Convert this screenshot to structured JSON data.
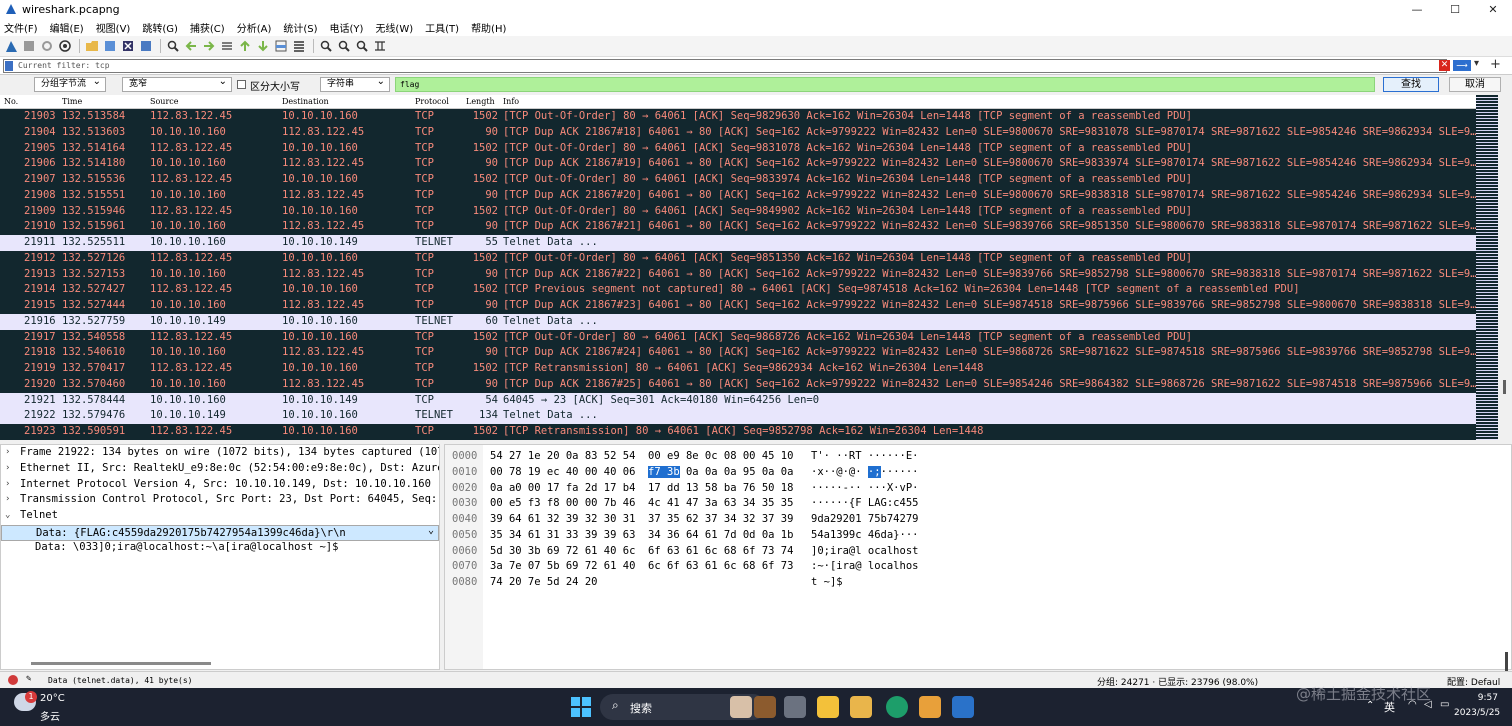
{
  "window": {
    "title": "wireshark.pcapng",
    "minimize": "—",
    "maximize": "☐",
    "close": "✕"
  },
  "menu": [
    "文件(F)",
    "编辑(E)",
    "视图(V)",
    "跳转(G)",
    "捕获(C)",
    "分析(A)",
    "统计(S)",
    "电话(Y)",
    "无线(W)",
    "工具(T)",
    "帮助(H)"
  ],
  "toolbar_icons": [
    "fin-icon",
    "stop-icon",
    "restart-icon",
    "options-icon",
    "open-icon",
    "save-icon",
    "close-file-icon",
    "reload-icon",
    "find-icon",
    "back-icon",
    "forward-icon",
    "goto-icon",
    "first-icon",
    "last-icon",
    "autoscroll-icon",
    "colorize-icon",
    "zoom-in-icon",
    "zoom-out-icon",
    "zoom-reset-icon",
    "resize-columns-icon"
  ],
  "filter": {
    "placeholder": "Current filter: tcp"
  },
  "search": {
    "scope": "分组字节流",
    "charset": "宽窄",
    "case_label": "区分大小写",
    "type": "字符串",
    "query": "flag",
    "find_label": "查找",
    "cancel_label": "取消"
  },
  "columns": [
    "No.",
    "Time",
    "Source",
    "Destination",
    "Protocol",
    "Length",
    "Info"
  ],
  "packets": [
    {
      "no": "21903",
      "time": "132.513584",
      "src": "112.83.122.45",
      "dst": "10.10.10.160",
      "proto": "TCP",
      "len": "1502",
      "info": "[TCP Out-Of-Order] 80 → 64061 [ACK] Seq=9829630 Ack=162 Win=26304 Len=1448 [TCP segment of a reassembled PDU]",
      "light": false
    },
    {
      "no": "21904",
      "time": "132.513603",
      "src": "10.10.10.160",
      "dst": "112.83.122.45",
      "proto": "TCP",
      "len": "90",
      "info": "[TCP Dup ACK 21867#18] 64061 → 80 [ACK] Seq=162 Ack=9799222 Win=82432 Len=0 SLE=9800670 SRE=9831078 SLE=9870174 SRE=9871622 SLE=9854246 SRE=9862934 SLE=9…",
      "light": false
    },
    {
      "no": "21905",
      "time": "132.514164",
      "src": "112.83.122.45",
      "dst": "10.10.10.160",
      "proto": "TCP",
      "len": "1502",
      "info": "[TCP Out-Of-Order] 80 → 64061 [ACK] Seq=9831078 Ack=162 Win=26304 Len=1448 [TCP segment of a reassembled PDU]",
      "light": false
    },
    {
      "no": "21906",
      "time": "132.514180",
      "src": "10.10.10.160",
      "dst": "112.83.122.45",
      "proto": "TCP",
      "len": "90",
      "info": "[TCP Dup ACK 21867#19] 64061 → 80 [ACK] Seq=162 Ack=9799222 Win=82432 Len=0 SLE=9800670 SRE=9833974 SLE=9870174 SRE=9871622 SLE=9854246 SRE=9862934 SLE=9…",
      "light": false
    },
    {
      "no": "21907",
      "time": "132.515536",
      "src": "112.83.122.45",
      "dst": "10.10.10.160",
      "proto": "TCP",
      "len": "1502",
      "info": "[TCP Out-Of-Order] 80 → 64061 [ACK] Seq=9833974 Ack=162 Win=26304 Len=1448 [TCP segment of a reassembled PDU]",
      "light": false
    },
    {
      "no": "21908",
      "time": "132.515551",
      "src": "10.10.10.160",
      "dst": "112.83.122.45",
      "proto": "TCP",
      "len": "90",
      "info": "[TCP Dup ACK 21867#20] 64061 → 80 [ACK] Seq=162 Ack=9799222 Win=82432 Len=0 SLE=9800670 SRE=9838318 SLE=9870174 SRE=9871622 SLE=9854246 SRE=9862934 SLE=9…",
      "light": false
    },
    {
      "no": "21909",
      "time": "132.515946",
      "src": "112.83.122.45",
      "dst": "10.10.10.160",
      "proto": "TCP",
      "len": "1502",
      "info": "[TCP Out-Of-Order] 80 → 64061 [ACK] Seq=9849902 Ack=162 Win=26304 Len=1448 [TCP segment of a reassembled PDU]",
      "light": false
    },
    {
      "no": "21910",
      "time": "132.515961",
      "src": "10.10.10.160",
      "dst": "112.83.122.45",
      "proto": "TCP",
      "len": "90",
      "info": "[TCP Dup ACK 21867#21] 64061 → 80 [ACK] Seq=162 Ack=9799222 Win=82432 Len=0 SLE=9839766 SRE=9851350 SLE=9800670 SRE=9838318 SLE=9870174 SRE=9871622 SLE=9…",
      "light": false
    },
    {
      "no": "21911",
      "time": "132.525511",
      "src": "10.10.10.160",
      "dst": "10.10.10.149",
      "proto": "TELNET",
      "len": "55",
      "info": "Telnet Data ...",
      "light": true
    },
    {
      "no": "21912",
      "time": "132.527126",
      "src": "112.83.122.45",
      "dst": "10.10.10.160",
      "proto": "TCP",
      "len": "1502",
      "info": "[TCP Out-Of-Order] 80 → 64061 [ACK] Seq=9851350 Ack=162 Win=26304 Len=1448 [TCP segment of a reassembled PDU]",
      "light": false
    },
    {
      "no": "21913",
      "time": "132.527153",
      "src": "10.10.10.160",
      "dst": "112.83.122.45",
      "proto": "TCP",
      "len": "90",
      "info": "[TCP Dup ACK 21867#22] 64061 → 80 [ACK] Seq=162 Ack=9799222 Win=82432 Len=0 SLE=9839766 SRE=9852798 SLE=9800670 SRE=9838318 SLE=9870174 SRE=9871622 SLE=9…",
      "light": false
    },
    {
      "no": "21914",
      "time": "132.527427",
      "src": "112.83.122.45",
      "dst": "10.10.10.160",
      "proto": "TCP",
      "len": "1502",
      "info": "[TCP Previous segment not captured] 80 → 64061 [ACK] Seq=9874518 Ack=162 Win=26304 Len=1448 [TCP segment of a reassembled PDU]",
      "light": false
    },
    {
      "no": "21915",
      "time": "132.527444",
      "src": "10.10.10.160",
      "dst": "112.83.122.45",
      "proto": "TCP",
      "len": "90",
      "info": "[TCP Dup ACK 21867#23] 64061 → 80 [ACK] Seq=162 Ack=9799222 Win=82432 Len=0 SLE=9874518 SRE=9875966 SLE=9839766 SRE=9852798 SLE=9800670 SRE=9838318 SLE=9…",
      "light": false
    },
    {
      "no": "21916",
      "time": "132.527759",
      "src": "10.10.10.149",
      "dst": "10.10.10.160",
      "proto": "TELNET",
      "len": "60",
      "info": "Telnet Data ...",
      "light": true
    },
    {
      "no": "21917",
      "time": "132.540558",
      "src": "112.83.122.45",
      "dst": "10.10.10.160",
      "proto": "TCP",
      "len": "1502",
      "info": "[TCP Out-Of-Order] 80 → 64061 [ACK] Seq=9868726 Ack=162 Win=26304 Len=1448 [TCP segment of a reassembled PDU]",
      "light": false
    },
    {
      "no": "21918",
      "time": "132.540610",
      "src": "10.10.10.160",
      "dst": "112.83.122.45",
      "proto": "TCP",
      "len": "90",
      "info": "[TCP Dup ACK 21867#24] 64061 → 80 [ACK] Seq=162 Ack=9799222 Win=82432 Len=0 SLE=9868726 SRE=9871622 SLE=9874518 SRE=9875966 SLE=9839766 SRE=9852798 SLE=9…",
      "light": false
    },
    {
      "no": "21919",
      "time": "132.570417",
      "src": "112.83.122.45",
      "dst": "10.10.10.160",
      "proto": "TCP",
      "len": "1502",
      "info": "[TCP Retransmission] 80 → 64061 [ACK] Seq=9862934 Ack=162 Win=26304 Len=1448",
      "light": false
    },
    {
      "no": "21920",
      "time": "132.570460",
      "src": "10.10.10.160",
      "dst": "112.83.122.45",
      "proto": "TCP",
      "len": "90",
      "info": "[TCP Dup ACK 21867#25] 64061 → 80 [ACK] Seq=162 Ack=9799222 Win=82432 Len=0 SLE=9854246 SRE=9864382 SLE=9868726 SRE=9871622 SLE=9874518 SRE=9875966 SLE=9…",
      "light": false
    },
    {
      "no": "21921",
      "time": "132.578444",
      "src": "10.10.10.160",
      "dst": "10.10.10.149",
      "proto": "TCP",
      "len": "54",
      "info": "64045 → 23 [ACK] Seq=301 Ack=40180 Win=64256 Len=0",
      "light": true
    },
    {
      "no": "21922",
      "time": "132.579476",
      "src": "10.10.10.149",
      "dst": "10.10.10.160",
      "proto": "TELNET",
      "len": "134",
      "info": "Telnet Data ...",
      "light": true
    },
    {
      "no": "21923",
      "time": "132.590591",
      "src": "112.83.122.45",
      "dst": "10.10.10.160",
      "proto": "TCP",
      "len": "1502",
      "info": "[TCP Retransmission] 80 → 64061 [ACK] Seq=9852798 Ack=162 Win=26304 Len=1448",
      "light": false
    }
  ],
  "details": [
    {
      "arrow": "›",
      "text": "Frame 21922: 134 bytes on wire (1072 bits), 134 bytes captured (107",
      "sub": false,
      "selected": false
    },
    {
      "arrow": "›",
      "text": "Ethernet II, Src: RealtekU_e9:8e:0c (52:54:00:e9:8e:0c), Dst: Azure",
      "sub": false,
      "selected": false
    },
    {
      "arrow": "›",
      "text": "Internet Protocol Version 4, Src: 10.10.10.149, Dst: 10.10.10.160",
      "sub": false,
      "selected": false
    },
    {
      "arrow": "›",
      "text": "Transmission Control Protocol, Src Port: 23, Dst Port: 64045, Seq:",
      "sub": false,
      "selected": false
    },
    {
      "arrow": "⌄",
      "text": "Telnet",
      "sub": false,
      "selected": false
    },
    {
      "arrow": "",
      "text": "Data: {FLAG:c4559da2920175b7427954a1399c46da}\\r\\n",
      "sub": true,
      "selected": true
    },
    {
      "arrow": "",
      "text": "Data: \\033]0;ira@localhost:~\\a[ira@localhost ~]$",
      "sub": true,
      "selected": false
    }
  ],
  "bytes": [
    {
      "off": "0000",
      "hex": "54 27 1e 20 0a 83 52 54  00 e9 8e 0c 08 00 45 10",
      "asc": "T'· ··RT ······E·"
    },
    {
      "off": "0010",
      "hex_pre": "00 78 19 ec 40 00 40 06  ",
      "hex_hl": "f7 3b",
      "hex_post": " 0a 0a 0a 95 0a 0a",
      "asc_pre": "·x··@·@· ",
      "asc_hl": "·;",
      "asc_post": "······"
    },
    {
      "off": "0020",
      "hex": "0a a0 00 17 fa 2d 17 b4  17 dd 13 58 ba 76 50 18",
      "asc": "·····-·· ···X·vP·"
    },
    {
      "off": "0030",
      "hex": "00 e5 f3 f8 00 00 7b 46  4c 41 47 3a 63 34 35 35",
      "asc": "······{F LAG:c455"
    },
    {
      "off": "0040",
      "hex": "39 64 61 32 39 32 30 31  37 35 62 37 34 32 37 39",
      "asc": "9da29201 75b74279"
    },
    {
      "off": "0050",
      "hex": "35 34 61 31 33 39 39 63  34 36 64 61 7d 0d 0a 1b",
      "asc": "54a1399c 46da}···"
    },
    {
      "off": "0060",
      "hex": "5d 30 3b 69 72 61 40 6c  6f 63 61 6c 68 6f 73 74",
      "asc": "]0;ira@l ocalhost"
    },
    {
      "off": "0070",
      "hex": "3a 7e 07 5b 69 72 61 40  6c 6f 63 61 6c 68 6f 73",
      "asc": ":~·[ira@ localhos"
    },
    {
      "off": "0080",
      "hex": "74 20 7e 5d 24 20",
      "asc": "t ~]$"
    }
  ],
  "status": {
    "field": "Data (telnet.data), 41 byte(s)",
    "counts": "分组: 24271 · 已显示: 23796 (98.0%)",
    "profile": "配置: Defaul"
  },
  "taskbar": {
    "badge": "1",
    "temp": "20°C",
    "cond": "多云",
    "search": "搜索",
    "lang": "英",
    "time": "9:57",
    "date": "2023/5/25"
  },
  "watermark": "@稀土掘金技术社区",
  "colors": {
    "dark_row": "#12272e",
    "dark_text": "#f78a7b",
    "light_row": "#e8e6fc",
    "search_bg": "#aff09a",
    "accent": "#1f6fd0"
  }
}
